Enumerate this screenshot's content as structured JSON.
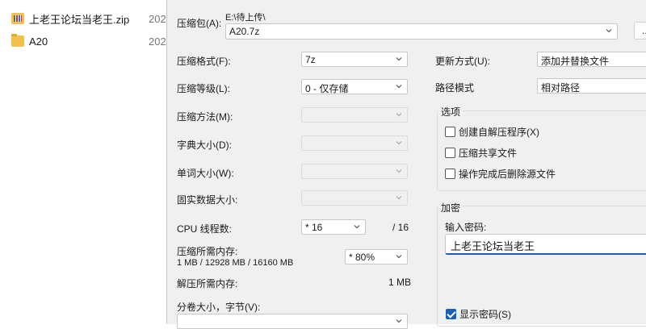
{
  "explorer": {
    "rows": [
      {
        "name": "上老王论坛当老王.zip",
        "date": "202",
        "icon": "zip-archive-icon"
      },
      {
        "name": "A20",
        "date": "202",
        "icon": "folder-icon"
      }
    ]
  },
  "archive": {
    "label": "压缩包(A):",
    "path": "E:\\待上传\\",
    "filename": "A20.7z",
    "browse_label": "..."
  },
  "left": {
    "format_label": "压缩格式(F):",
    "format_value": "7z",
    "level_label": "压缩等级(L):",
    "level_value": "0 - 仅存储",
    "method_label": "压缩方法(M):",
    "method_value": "",
    "dict_label": "字典大小(D):",
    "dict_value": "",
    "word_label": "单词大小(W):",
    "word_value": "",
    "solid_label": "固实数据大小:",
    "solid_value": "",
    "threads_label": "CPU 线程数:",
    "threads_value": "* 16",
    "threads_max": "/ 16",
    "mem_comp_label": "压缩所需内存:",
    "mem_comp_value": "1 MB / 12928 MB / 16160 MB",
    "mem_percent": "* 80%",
    "mem_decomp_label": "解压所需内存:",
    "mem_decomp_value": "1 MB",
    "volume_label": "分卷大小，字节(V):",
    "volume_value": ""
  },
  "right": {
    "update_label": "更新方式(U):",
    "update_value": "添加并替换文件",
    "path_label": "路径模式",
    "path_value": "相对路径",
    "options_legend": "选项",
    "options": [
      {
        "label": "创建自解压程序(X)",
        "checked": false
      },
      {
        "label": "压缩共享文件",
        "checked": false
      },
      {
        "label": "操作完成后删除源文件",
        "checked": false
      }
    ],
    "encrypt_legend": "加密",
    "password_label": "输入密码:",
    "password_value": "上老王论坛当老王",
    "show_password_label": "显示密码(S)",
    "show_password_checked": true
  },
  "colors": {
    "accent": "#1a5fb4",
    "dialog_bg": "#f0f0f0"
  }
}
